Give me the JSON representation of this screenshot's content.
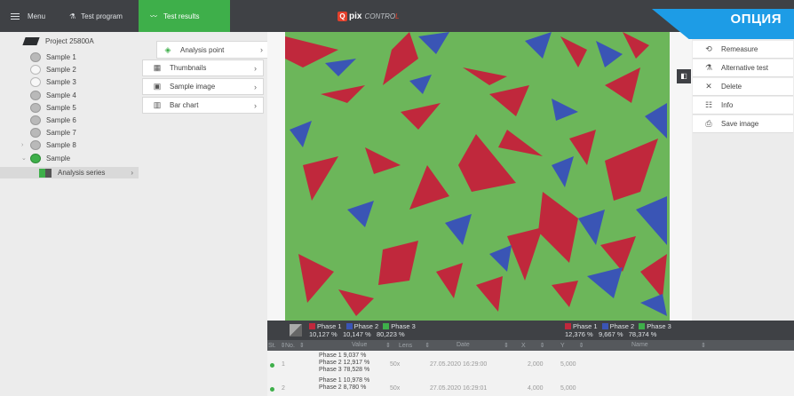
{
  "topbar": {
    "menu_label": "Menu",
    "program_label": "Test program",
    "results_label": "Test results",
    "logo_main": "pix",
    "logo_sub_prefix": "CONTRO",
    "logo_sub_accent": "L",
    "option_label": "ОПЦИЯ"
  },
  "tree": {
    "project": "Project 25800A",
    "items": [
      {
        "label": "Sample 1",
        "state": "gray"
      },
      {
        "label": "Sample 2",
        "state": "empty"
      },
      {
        "label": "Sample 3",
        "state": "empty"
      },
      {
        "label": "Sample 4",
        "state": "gray"
      },
      {
        "label": "Sample 5",
        "state": "gray"
      },
      {
        "label": "Sample 6",
        "state": "gray"
      },
      {
        "label": "Sample 7",
        "state": "gray"
      },
      {
        "label": "Sample 8",
        "state": "gray"
      },
      {
        "label": "Sample",
        "state": "green"
      }
    ],
    "series_label": "Analysis series"
  },
  "menu": {
    "analysis_point": "Analysis point",
    "thumbnails": "Thumbnails",
    "sample_image": "Sample image",
    "bar_chart": "Bar chart"
  },
  "right_panel": {
    "remeasure": "Remeasure",
    "alternative_test": "Alternative test",
    "delete": "Delete",
    "info": "Info",
    "save_image": "Save image"
  },
  "summary": {
    "left": {
      "p1": "Phase 1",
      "p2": "Phase 2",
      "p3": "Phase 3",
      "v1": "10,127 %",
      "v2": "10,147 %",
      "v3": "80,223 %"
    },
    "right": {
      "p1": "Phase 1",
      "p2": "Phase 2",
      "p3": "Phase 3",
      "v1": "12,376 %",
      "v2": "9,667 %",
      "v3": "78,374 %"
    }
  },
  "colors": {
    "phase1": "#c0283c",
    "phase2": "#3a55b5",
    "phase3": "#3eaf4a",
    "accent": "#1d9ce6"
  },
  "table": {
    "headers": {
      "st": "St.",
      "no": "No.",
      "value": "Value",
      "lens": "Lens",
      "date": "Date",
      "x": "X",
      "y": "Y",
      "name": "Name"
    },
    "rows": [
      {
        "no": "1",
        "v1": "Phase 1 9,037 %",
        "v2": "Phase 2 12,917 %",
        "v3": "Phase 3 78,528 %",
        "lens": "50x",
        "date": "27.05.2020 16:29:00",
        "x": "2,000",
        "y": "5,000"
      },
      {
        "no": "2",
        "v1": "Phase 1 10,978 %",
        "v2": "Phase 2 8,780 %",
        "v3": "",
        "lens": "50x",
        "date": "27.05.2020 16:29:01",
        "x": "4,000",
        "y": "5,000"
      }
    ]
  }
}
